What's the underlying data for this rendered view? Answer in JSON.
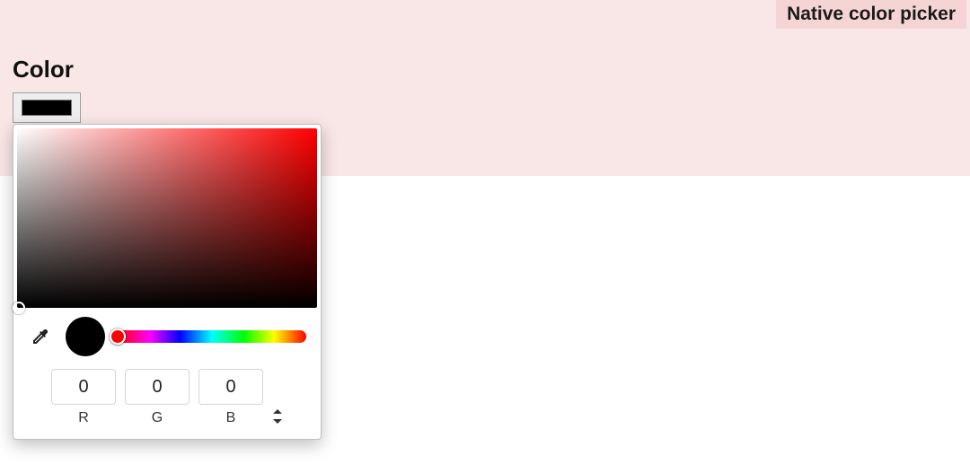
{
  "section": {
    "badge": "Native color picker",
    "label": "Color",
    "swatch_color": "#000000"
  },
  "picker": {
    "hue": 0,
    "preview_color": "#000000",
    "channels": {
      "r": {
        "value": "0",
        "label": "R"
      },
      "g": {
        "value": "0",
        "label": "G"
      },
      "b": {
        "value": "0",
        "label": "B"
      }
    },
    "icons": {
      "eyedropper": "eyedropper-icon",
      "format_toggle": "updown-icon"
    }
  }
}
